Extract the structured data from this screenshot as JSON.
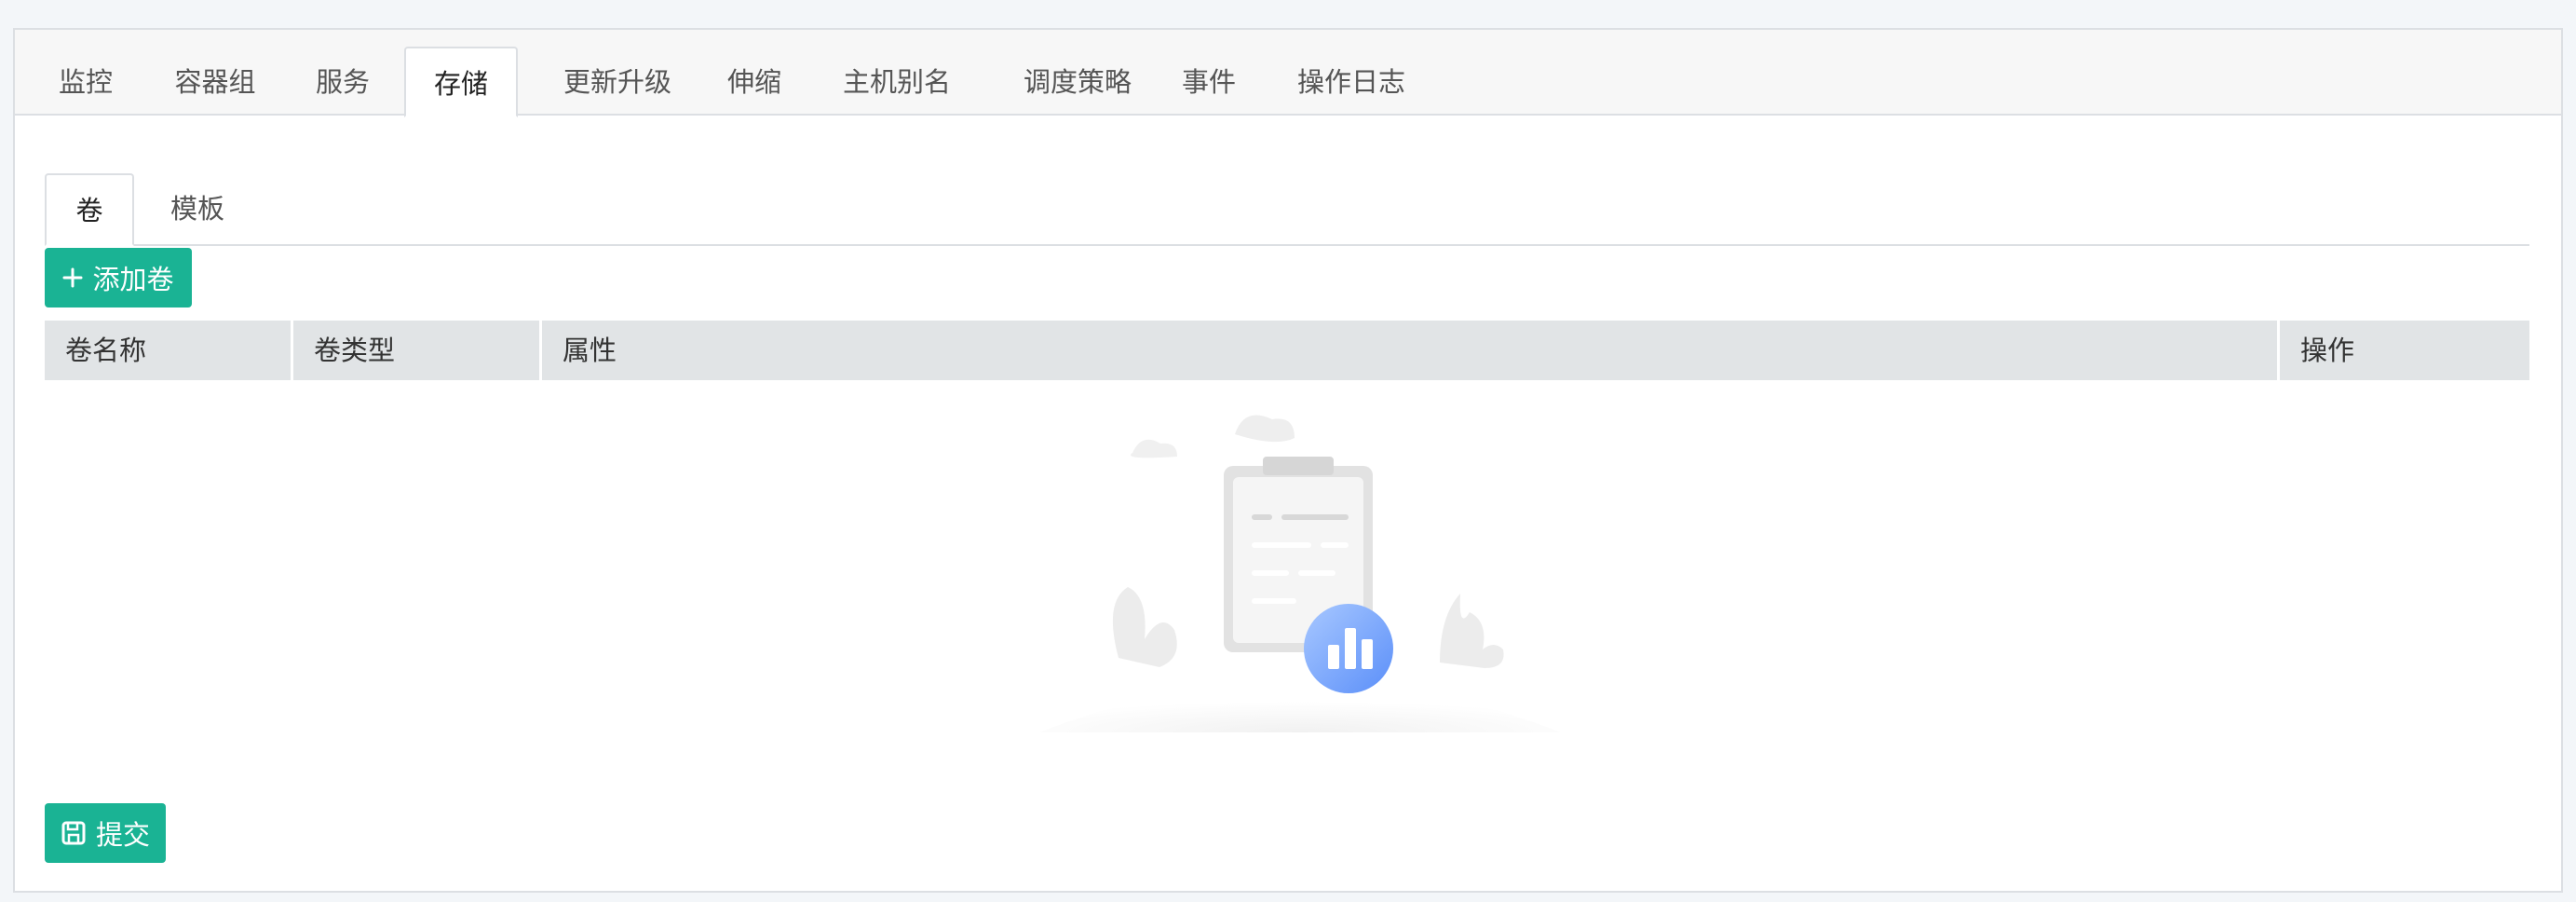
{
  "top_tabs": [
    {
      "label": "监控"
    },
    {
      "label": "容器组"
    },
    {
      "label": "服务"
    },
    {
      "label": "存储"
    },
    {
      "label": "更新升级"
    },
    {
      "label": "伸缩"
    },
    {
      "label": "主机别名"
    },
    {
      "label": "调度策略"
    },
    {
      "label": "事件"
    },
    {
      "label": "操作日志"
    }
  ],
  "active_top_tab": "存储",
  "sub_tabs": [
    {
      "label": "卷"
    },
    {
      "label": "模板"
    }
  ],
  "active_sub_tab": "卷",
  "add_button": {
    "label": "添加卷",
    "icon": "plus-icon"
  },
  "table": {
    "columns": [
      "卷名称",
      "卷类型",
      "属性",
      "操作"
    ],
    "rows": []
  },
  "empty_state": {
    "icon": "empty-clipboard-chart-illustration"
  },
  "submit_button": {
    "label": "提交",
    "icon": "save-icon"
  },
  "colors": {
    "primary": "#1ab394",
    "header_bg": "#e1e4e6",
    "tab_bar_bg": "#f7f7f7",
    "border": "#dcdfe3",
    "empty_icon_blue": "#5b8ff9"
  }
}
